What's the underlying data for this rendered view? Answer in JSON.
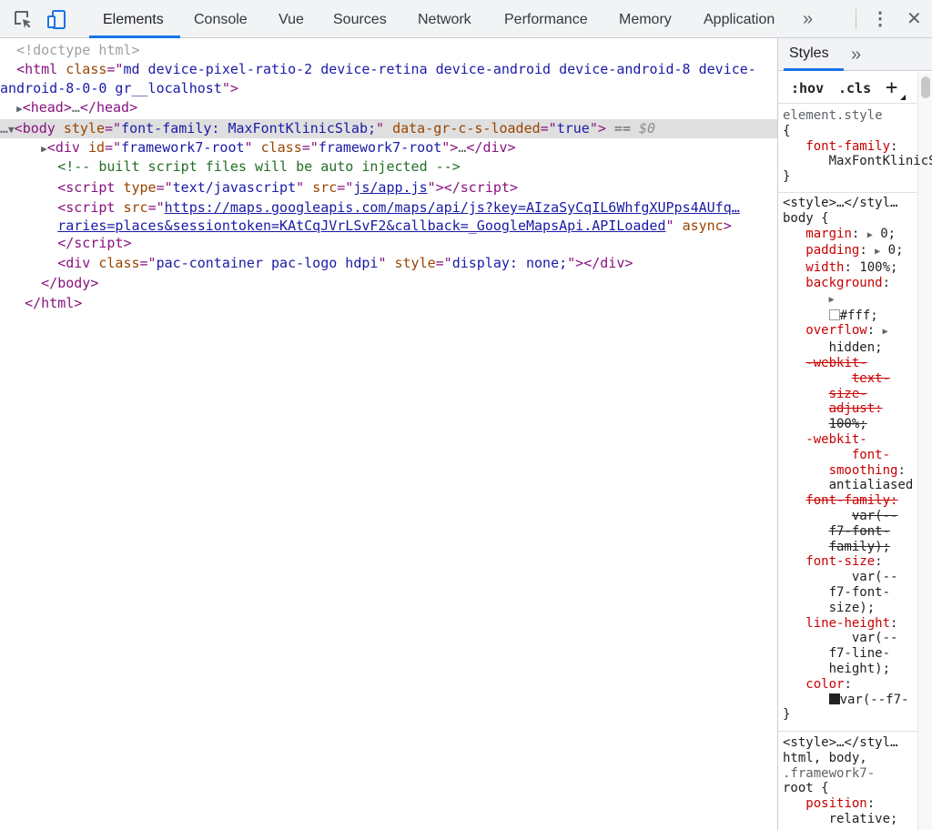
{
  "toolbar": {
    "tabs": [
      "Elements",
      "Console",
      "Vue",
      "Sources",
      "Network",
      "Performance",
      "Memory",
      "Application"
    ],
    "more": "»",
    "menu": "⋮",
    "close": "✕"
  },
  "dom": {
    "doctype": "<!doctype html>",
    "html_tag": "html",
    "class_attr": "class",
    "html_class_1": "md device-pixel-ratio-2 device-retina device-android device-android-8 device-",
    "html_class_2": "android-8-0-0 gr__localhost",
    "head_tag": "head",
    "ellipsis": "…",
    "body_tag": "body",
    "style_attr": "style",
    "body_style": "font-family: MaxFontKlinicSlab;",
    "data_attr": "data-gr-c-s-loaded",
    "data_val": "true",
    "eq_sign": " == ",
    "dollar_zero": "$0",
    "div_tag": "div",
    "id_attr": "id",
    "div_id": "framework7-root",
    "div_class": "framework7-root",
    "comment": "<!-- built script files will be auto injected -->",
    "script_tag": "script",
    "type_attr": "type",
    "script_type": "text/javascript",
    "src_attr": "src",
    "script_src": "js/app.js",
    "maps_src_1": "https://maps.googleapis.com/maps/api/js?key=AIzaSyCqIL6WhfgXUPps4AUfq…",
    "maps_src_2": "raries=places&sessiontoken=KAtCqJVrLSvF2&callback=_GoogleMapsApi.APILoaded",
    "async_attr": "async",
    "pac_class": "pac-container pac-logo hdpi",
    "pac_style": "display: none;"
  },
  "styles": {
    "tab": "Styles",
    "more": "»",
    "hov": ":hov",
    "cls": ".cls",
    "add": "+",
    "element_style": "element.style",
    "open_brace": "{",
    "close_brace": "}",
    "font_family_prop": "font-family",
    "font_family_val": "MaxFontKlinicSlab",
    "style_source": "<style>…</styl…",
    "body_selector": "body {",
    "margin": "margin",
    "margin_val": "0;",
    "padding": "padding",
    "padding_val": "0;",
    "width": "width",
    "width_val": "100%;",
    "background": "background",
    "bg_val": "#fff;",
    "overflow": "overflow",
    "overflow_val": "hidden;",
    "tsa_1": "-webkit-",
    "tsa_2": "text-",
    "tsa_3": "size-",
    "tsa_4": "adjust:",
    "tsa_val": "100%;",
    "fsm_1": "-webkit-",
    "fsm_2": "font-",
    "fsm_3": "smoothing",
    "fsm_val": "antialiased",
    "ff_prop": "font-family:",
    "ff_val_1": "var(--",
    "ff_val_2": "f7-font-",
    "ff_val_3": "family);",
    "fs_prop": "font-size",
    "fs_val_1": "var(--",
    "fs_val_2": "f7-font-",
    "fs_val_3": "size);",
    "lh_prop": "line-height",
    "lh_val_1": "var(--",
    "lh_val_2": "f7-line-",
    "lh_val_3": "height);",
    "color_prop": "color",
    "color_val": "var(--f7-",
    "html_selector_1": "html, body,",
    "html_selector_2": ".framework7-",
    "html_selector_3": "root {",
    "position": "position",
    "position_val": "relative;"
  }
}
